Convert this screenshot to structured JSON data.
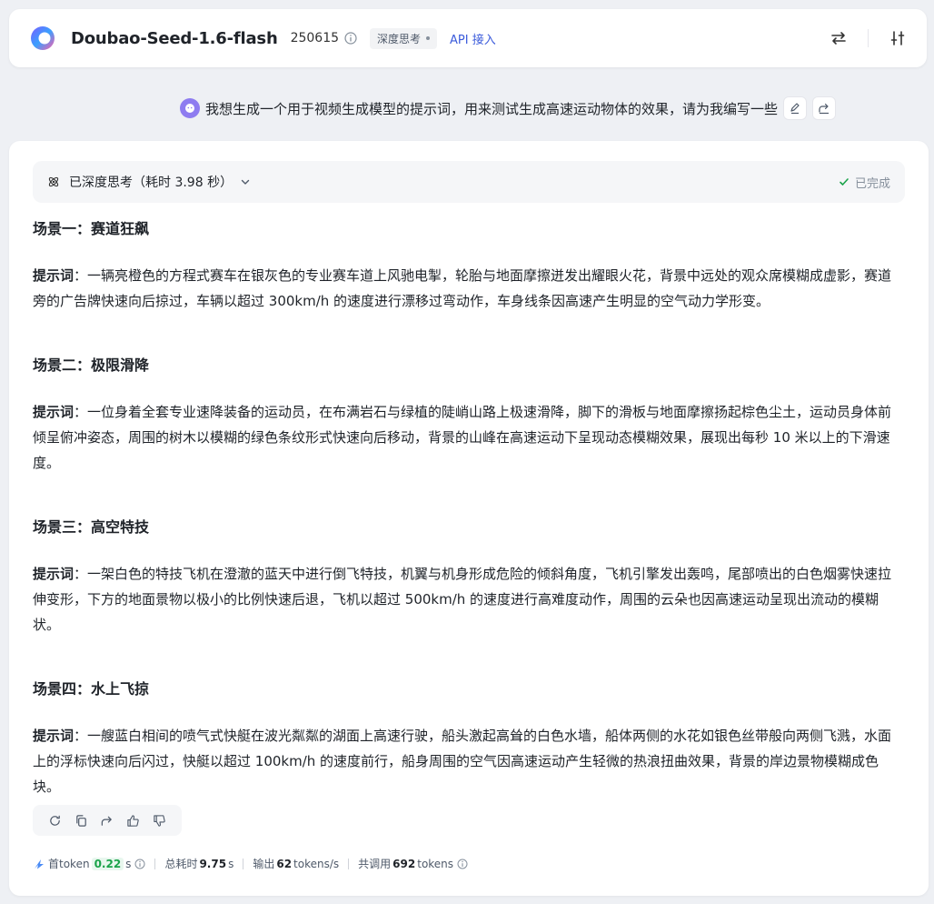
{
  "header": {
    "model_name": "Doubao-Seed-1.6-flash",
    "version": "250615",
    "deep_think_badge": "深度思考",
    "api_link": "API 接入"
  },
  "user_message": {
    "text": "我想生成一个用于视频生成模型的提示词，用来测试生成高速运动物体的效果，请为我编写一些"
  },
  "thinking": {
    "label": "已深度思考（耗时 3.98 秒）",
    "status": "已完成"
  },
  "scenes": [
    {
      "title": "场景一：赛道狂飙",
      "prompt_label": "提示词",
      "prompt_text": "：一辆亮橙色的方程式赛车在银灰色的专业赛车道上风驰电掣，轮胎与地面摩擦迸发出耀眼火花，背景中远处的观众席模糊成虚影，赛道旁的广告牌快速向后掠过，车辆以超过 300km/h 的速度进行漂移过弯动作，车身线条因高速产生明显的空气动力学形变。"
    },
    {
      "title": "场景二：极限滑降",
      "prompt_label": "提示词",
      "prompt_text": "：一位身着全套专业速降装备的运动员，在布满岩石与绿植的陡峭山路上极速滑降，脚下的滑板与地面摩擦扬起棕色尘土，运动员身体前倾呈俯冲姿态，周围的树木以模糊的绿色条纹形式快速向后移动，背景的山峰在高速运动下呈现动态模糊效果，展现出每秒 10 米以上的下滑速度。"
    },
    {
      "title": "场景三：高空特技",
      "prompt_label": "提示词",
      "prompt_text": "：一架白色的特技飞机在澄澈的蓝天中进行倒飞特技，机翼与机身形成危险的倾斜角度，飞机引擎发出轰鸣，尾部喷出的白色烟雾快速拉伸变形，下方的地面景物以极小的比例快速后退，飞机以超过 500km/h 的速度进行高难度动作，周围的云朵也因高速运动呈现出流动的模糊状。"
    },
    {
      "title": "场景四：水上飞掠",
      "prompt_label": "提示词",
      "prompt_text": "：一艘蓝白相间的喷气式快艇在波光粼粼的湖面上高速行驶，船头激起高耸的白色水墙，船体两侧的水花如银色丝带般向两侧飞溅，水面上的浮标快速向后闪过，快艇以超过 100km/h 的速度前行，船身周围的空气因高速运动产生轻微的热浪扭曲效果，背景的岸边景物模糊成色块。"
    }
  ],
  "stats": {
    "first_token_label": "首token",
    "first_token_value": "0.22",
    "first_token_unit": "s",
    "total_label": "总耗时",
    "total_value": "9.75",
    "total_unit": "s",
    "output_label": "输出",
    "output_value": "62",
    "output_unit": "tokens/s",
    "calls_label": "共调用",
    "calls_value": "692",
    "calls_unit": "tokens"
  },
  "colors": {
    "accent": "#3b5bdb",
    "avatar": "#8e7cf0",
    "success": "#1aa34a"
  }
}
